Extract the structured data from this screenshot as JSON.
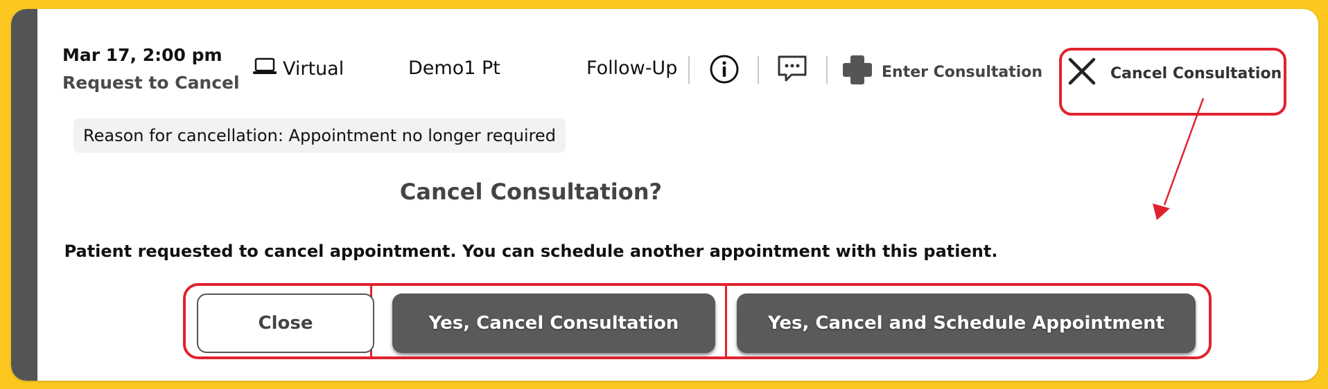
{
  "appointment": {
    "date_time": "Mar 17, 2:00 pm",
    "status": "Request to Cancel",
    "mode": "Virtual",
    "patient": "Demo1 Pt",
    "visit_type": "Follow-Up",
    "reason": "Reason for cancellation: Appointment no longer required"
  },
  "toolbar": {
    "enter_label": "Enter Consultation",
    "cancel_label": "Cancel Consultation"
  },
  "dialog": {
    "title": "Cancel Consultation?",
    "message": "Patient requested to cancel appointment. You can schedule another appointment with this patient.",
    "close_label": "Close",
    "yes_cancel_label": "Yes, Cancel Consultation",
    "yes_schedule_label": "Yes, Cancel and Schedule Appointment"
  },
  "icons": {
    "mode": "laptop-icon",
    "info": "info-icon",
    "message": "message-icon",
    "enter": "plus-cross-icon",
    "cancel": "close-x-icon"
  },
  "colors": {
    "frame": "#fcc81f",
    "highlight": "#e1222e",
    "dark_button": "#5a5a5a",
    "side_bar": "#545454"
  }
}
